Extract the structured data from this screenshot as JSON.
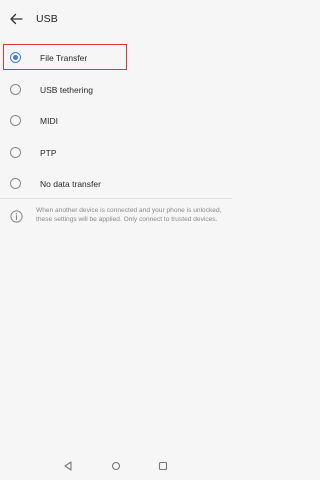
{
  "header": {
    "title": "USB"
  },
  "options": [
    {
      "label": "File Transfer",
      "selected": true
    },
    {
      "label": "USB tethering",
      "selected": false
    },
    {
      "label": "MIDI",
      "selected": false
    },
    {
      "label": "PTP",
      "selected": false
    },
    {
      "label": "No data transfer",
      "selected": false
    }
  ],
  "info": {
    "text": "When another device is connected and your phone is unlocked, these settings will be applied. Only connect to trusted devices."
  },
  "icons": {
    "back": "back-arrow-icon",
    "info": "info-icon",
    "nav_back": "nav-back-icon",
    "nav_home": "nav-home-icon",
    "nav_recents": "nav-recents-icon"
  },
  "colors": {
    "accent": "#3f7de0",
    "highlight": "#d9363e",
    "background": "#f6f6f6"
  }
}
